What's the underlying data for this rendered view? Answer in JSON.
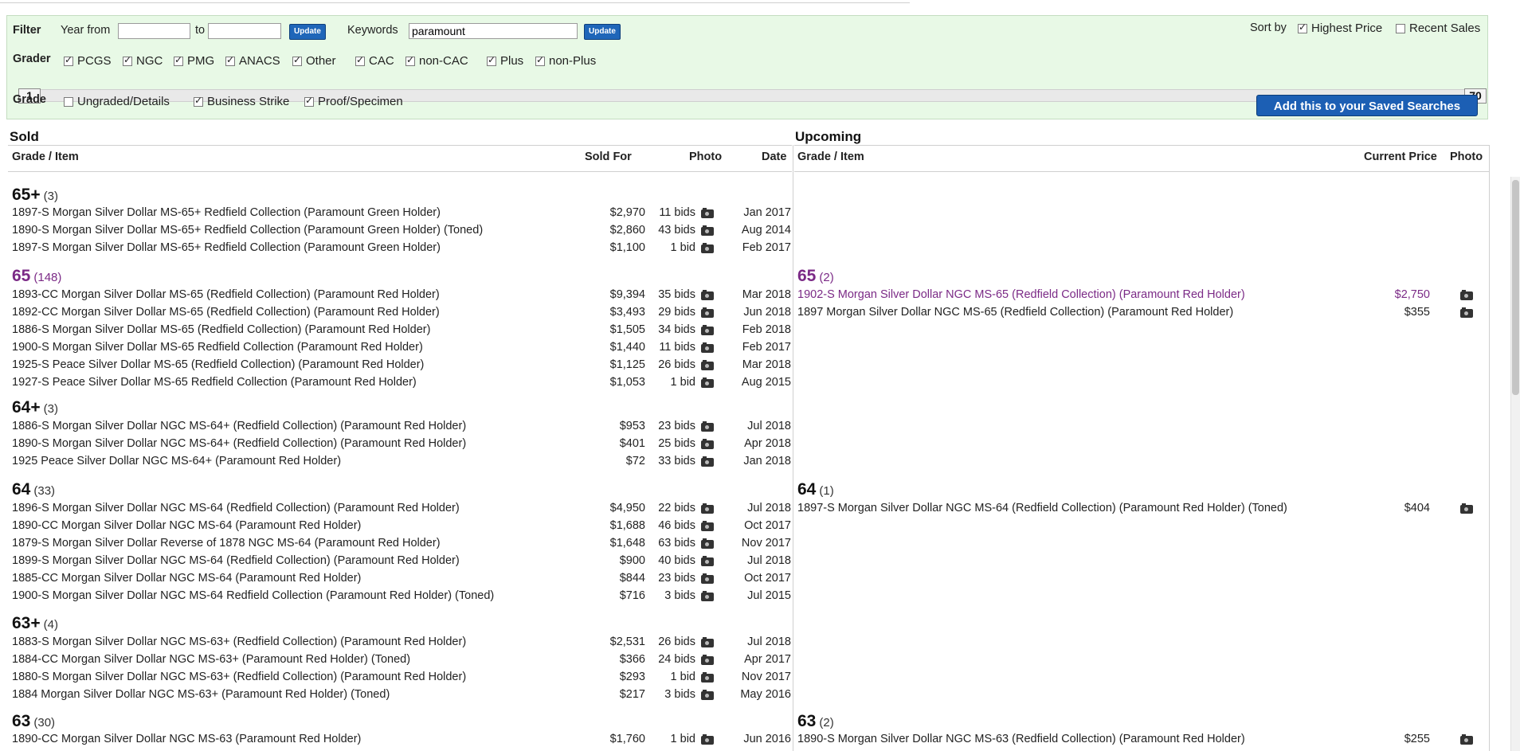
{
  "filter": {
    "label": "Filter",
    "year_from_label": "Year from",
    "year_from_value": "",
    "to_label": "to",
    "year_to_value": "",
    "update1": "Update",
    "keywords_label": "Keywords",
    "keywords_value": "paramount",
    "update2": "Update",
    "sort_by_label": "Sort by",
    "sort_highest": "Highest Price",
    "sort_recent": "Recent Sales",
    "grader_label": "Grader",
    "graders": [
      {
        "label": "PCGS",
        "checked": true
      },
      {
        "label": "NGC",
        "checked": true
      },
      {
        "label": "PMG",
        "checked": true
      },
      {
        "label": "ANACS",
        "checked": true
      },
      {
        "label": "Other",
        "checked": true
      },
      {
        "label": "CAC",
        "checked": true
      },
      {
        "label": "non-CAC",
        "checked": true
      },
      {
        "label": "Plus",
        "checked": true
      },
      {
        "label": "non-Plus",
        "checked": true
      }
    ],
    "slider_min": "1",
    "slider_max": "70",
    "grade_label": "Grade",
    "grade_options": [
      {
        "label": "Ungraded/Details",
        "checked": false
      },
      {
        "label": "Business Strike",
        "checked": true
      },
      {
        "label": "Proof/Specimen",
        "checked": true
      }
    ],
    "saved_search_button": "Add this to your Saved Searches"
  },
  "sold": {
    "title": "Sold",
    "headers": {
      "item": "Grade / Item",
      "sold_for": "Sold For",
      "photo": "Photo",
      "date": "Date"
    },
    "groups": [
      {
        "grade": "65+",
        "count": "(3)",
        "purple": false,
        "rows": [
          {
            "item": "1897-S Morgan Silver Dollar MS-65+ Redfield Collection (Paramount Green Holder)",
            "price": "$2,970",
            "bids": "11 bids",
            "date": "Jan 2017"
          },
          {
            "item": "1890-S Morgan Silver Dollar MS-65+ Redfield Collection (Paramount Green Holder) (Toned)",
            "price": "$2,860",
            "bids": "43 bids",
            "date": "Aug 2014"
          },
          {
            "item": "1897-S Morgan Silver Dollar MS-65+ Redfield Collection (Paramount Green Holder)",
            "price": "$1,100",
            "bids": "1 bid",
            "date": "Feb 2017"
          }
        ]
      },
      {
        "grade": "65",
        "count": "(148)",
        "purple": true,
        "rows": [
          {
            "item": "1893-CC Morgan Silver Dollar MS-65 (Redfield Collection) (Paramount Red Holder)",
            "price": "$9,394",
            "bids": "35 bids",
            "date": "Mar 2018"
          },
          {
            "item": "1892-CC Morgan Silver Dollar MS-65 (Redfield Collection) (Paramount Red Holder)",
            "price": "$3,493",
            "bids": "29 bids",
            "date": "Jun 2018"
          },
          {
            "item": "1886-S Morgan Silver Dollar MS-65 (Redfield Collection) (Paramount Red Holder)",
            "price": "$1,505",
            "bids": "34 bids",
            "date": "Feb 2018"
          },
          {
            "item": "1900-S Morgan Silver Dollar MS-65 Redfield Collection (Paramount Red Holder)",
            "price": "$1,440",
            "bids": "11 bids",
            "date": "Feb 2017"
          },
          {
            "item": "1925-S Peace Silver Dollar MS-65 (Redfield Collection) (Paramount Red Holder)",
            "price": "$1,125",
            "bids": "26 bids",
            "date": "Mar 2018"
          },
          {
            "item": "1927-S Peace Silver Dollar MS-65 Redfield Collection (Paramount Red Holder)",
            "price": "$1,053",
            "bids": "1 bid",
            "date": "Aug 2015"
          }
        ]
      },
      {
        "grade": "64+",
        "count": "(3)",
        "purple": false,
        "rows": [
          {
            "item": "1886-S Morgan Silver Dollar NGC MS-64+ (Redfield Collection) (Paramount Red Holder)",
            "price": "$953",
            "bids": "23 bids",
            "date": "Jul 2018"
          },
          {
            "item": "1890-S Morgan Silver Dollar NGC MS-64+ (Redfield Collection) (Paramount Red Holder)",
            "price": "$401",
            "bids": "25 bids",
            "date": "Apr 2018"
          },
          {
            "item": "1925 Peace Silver Dollar NGC MS-64+ (Paramount Red Holder)",
            "price": "$72",
            "bids": "33 bids",
            "date": "Jan 2018"
          }
        ]
      },
      {
        "grade": "64",
        "count": "(33)",
        "purple": false,
        "rows": [
          {
            "item": "1896-S Morgan Silver Dollar NGC MS-64 (Redfield Collection) (Paramount Red Holder)",
            "price": "$4,950",
            "bids": "22 bids",
            "date": "Jul 2018"
          },
          {
            "item": "1890-CC Morgan Silver Dollar NGC MS-64 (Paramount Red Holder)",
            "price": "$1,688",
            "bids": "46 bids",
            "date": "Oct 2017"
          },
          {
            "item": "1879-S Morgan Silver Dollar Reverse of 1878 NGC MS-64 (Paramount Red Holder)",
            "price": "$1,648",
            "bids": "63 bids",
            "date": "Nov 2017"
          },
          {
            "item": "1899-S Morgan Silver Dollar NGC MS-64 (Redfield Collection) (Paramount Red Holder)",
            "price": "$900",
            "bids": "40 bids",
            "date": "Jul 2018"
          },
          {
            "item": "1885-CC Morgan Silver Dollar NGC MS-64 (Paramount Red Holder)",
            "price": "$844",
            "bids": "23 bids",
            "date": "Oct 2017"
          },
          {
            "item": "1900-S Morgan Silver Dollar NGC MS-64 Redfield Collection (Paramount Red Holder) (Toned)",
            "price": "$716",
            "bids": "3 bids",
            "date": "Jul 2015"
          }
        ]
      },
      {
        "grade": "63+",
        "count": "(4)",
        "purple": false,
        "rows": [
          {
            "item": "1883-S Morgan Silver Dollar NGC MS-63+ (Redfield Collection) (Paramount Red Holder)",
            "price": "$2,531",
            "bids": "26 bids",
            "date": "Jul 2018"
          },
          {
            "item": "1884-CC Morgan Silver Dollar NGC MS-63+ (Paramount Red Holder) (Toned)",
            "price": "$366",
            "bids": "24 bids",
            "date": "Apr 2017"
          },
          {
            "item": "1880-S Morgan Silver Dollar NGC MS-63+ (Redfield Collection) (Paramount Red Holder)",
            "price": "$293",
            "bids": "1 bid",
            "date": "Nov 2017"
          },
          {
            "item": "1884 Morgan Silver Dollar NGC MS-63+ (Paramount Red Holder) (Toned)",
            "price": "$217",
            "bids": "3 bids",
            "date": "May 2016"
          }
        ]
      },
      {
        "grade": "63",
        "count": "(30)",
        "purple": false,
        "rows": [
          {
            "item": "1890-CC Morgan Silver Dollar NGC MS-63 (Paramount Red Holder)",
            "price": "$1,760",
            "bids": "1 bid",
            "date": "Jun 2016"
          }
        ]
      }
    ]
  },
  "upcoming": {
    "title": "Upcoming",
    "headers": {
      "item": "Grade / Item",
      "current_price": "Current Price",
      "photo": "Photo"
    },
    "groups": [
      {
        "grade": "65",
        "count": "(2)",
        "purple": true,
        "rows": [
          {
            "item": "1902-S Morgan Silver Dollar NGC MS-65 (Redfield Collection) (Paramount Red Holder)",
            "price": "$2,750",
            "purple": true
          },
          {
            "item": "1897 Morgan Silver Dollar NGC MS-65 (Redfield Collection) (Paramount Red Holder)",
            "price": "$355",
            "purple": false
          }
        ]
      },
      {
        "grade": "64",
        "count": "(1)",
        "purple": false,
        "rows": [
          {
            "item": "1897-S Morgan Silver Dollar NGC MS-64 (Redfield Collection) (Paramount Red Holder) (Toned)",
            "price": "$404",
            "purple": false
          }
        ]
      },
      {
        "grade": "63",
        "count": "(2)",
        "purple": false,
        "rows": [
          {
            "item": "1890-S Morgan Silver Dollar NGC MS-63 (Redfield Collection) (Paramount Red Holder)",
            "price": "$255",
            "purple": false
          }
        ]
      }
    ]
  }
}
